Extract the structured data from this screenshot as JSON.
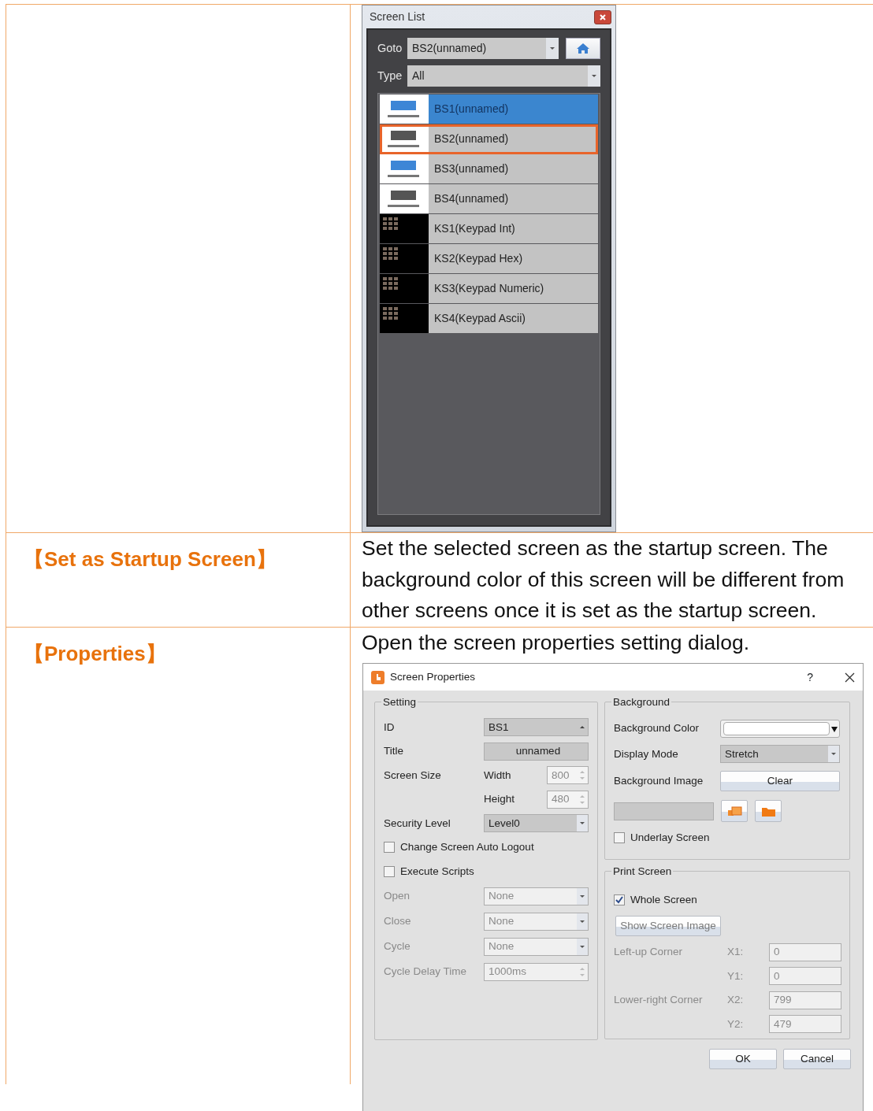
{
  "document_table": {
    "rows": [
      {
        "screen_list": {
          "title": "Screen List",
          "goto": {
            "label": "Goto",
            "value": "BS2(unnamed)"
          },
          "type": {
            "label": "Type",
            "value": "All"
          },
          "items": [
            {
              "name": "BS1(unnamed)",
              "kind": "base",
              "selected": true,
              "startup": false
            },
            {
              "name": "BS2(unnamed)",
              "kind": "base",
              "selected": false,
              "startup": true
            },
            {
              "name": "BS3(unnamed)",
              "kind": "base",
              "selected": false,
              "startup": false
            },
            {
              "name": "BS4(unnamed)",
              "kind": "base",
              "selected": false,
              "startup": false
            },
            {
              "name": "KS1(Keypad Int)",
              "kind": "keypad",
              "selected": false,
              "startup": false
            },
            {
              "name": "KS2(Keypad Hex)",
              "kind": "keypad",
              "selected": false,
              "startup": false
            },
            {
              "name": "KS3(Keypad Numeric)",
              "kind": "keypad",
              "selected": false,
              "startup": false
            },
            {
              "name": "KS4(Keypad Ascii)",
              "kind": "keypad",
              "selected": false,
              "startup": false
            }
          ]
        }
      },
      {
        "label": "【Set as Startup Screen】",
        "description": "Set the selected screen as the startup screen. The background color of this screen will be different from other screens once it is set as the startup screen."
      },
      {
        "label": "【Properties】",
        "description": "Open the screen properties setting dialog.",
        "dialog": {
          "title": "Screen Properties",
          "help": "?",
          "setting": {
            "title": "Setting",
            "id": {
              "label": "ID",
              "value": "BS1"
            },
            "title_field": {
              "label": "Title",
              "value": "unnamed"
            },
            "screen_size": {
              "label": "Screen Size",
              "width": {
                "label": "Width",
                "value": "800"
              },
              "height": {
                "label": "Height",
                "value": "480"
              }
            },
            "security_level": {
              "label": "Security Level",
              "value": "Level0"
            },
            "checkboxes": [
              {
                "label": "Change Screen Auto Logout",
                "checked": false
              },
              {
                "label": "Execute Scripts",
                "checked": false
              }
            ],
            "script_fields": [
              {
                "label": "Open",
                "value": "None",
                "kind": "dropdown",
                "disabled": true
              },
              {
                "label": "Close",
                "value": "None",
                "kind": "dropdown",
                "disabled": true
              },
              {
                "label": "Cycle",
                "value": "None",
                "kind": "dropdown",
                "disabled": true
              },
              {
                "label": "Cycle Delay Time",
                "value": "1000ms",
                "kind": "spinner",
                "disabled": true
              }
            ]
          },
          "background": {
            "title": "Background",
            "color": {
              "label": "Background Color"
            },
            "display_mode": {
              "label": "Display Mode",
              "value": "Stretch"
            },
            "image": {
              "label": "Background Image",
              "button": "Clear"
            },
            "underlay": {
              "label": "Underlay Screen",
              "checked": false
            }
          },
          "print_screen": {
            "title": "Print Screen",
            "whole_screen": {
              "label": "Whole Screen",
              "checked": true
            },
            "show_button": {
              "label": "Show Screen Image",
              "disabled": true
            },
            "corners": [
              {
                "label": "Left-up Corner",
                "disabled": true,
                "fields": [
                  {
                    "label": "X1:",
                    "value": "0"
                  },
                  {
                    "label": "Y1:",
                    "value": "0"
                  }
                ]
              },
              {
                "label": "Lower-right Corner",
                "disabled": true,
                "fields": [
                  {
                    "label": "X2:",
                    "value": "799"
                  },
                  {
                    "label": "Y2:",
                    "value": "479"
                  }
                ]
              }
            ]
          },
          "buttons": [
            "OK",
            "Cancel"
          ]
        }
      }
    ]
  }
}
